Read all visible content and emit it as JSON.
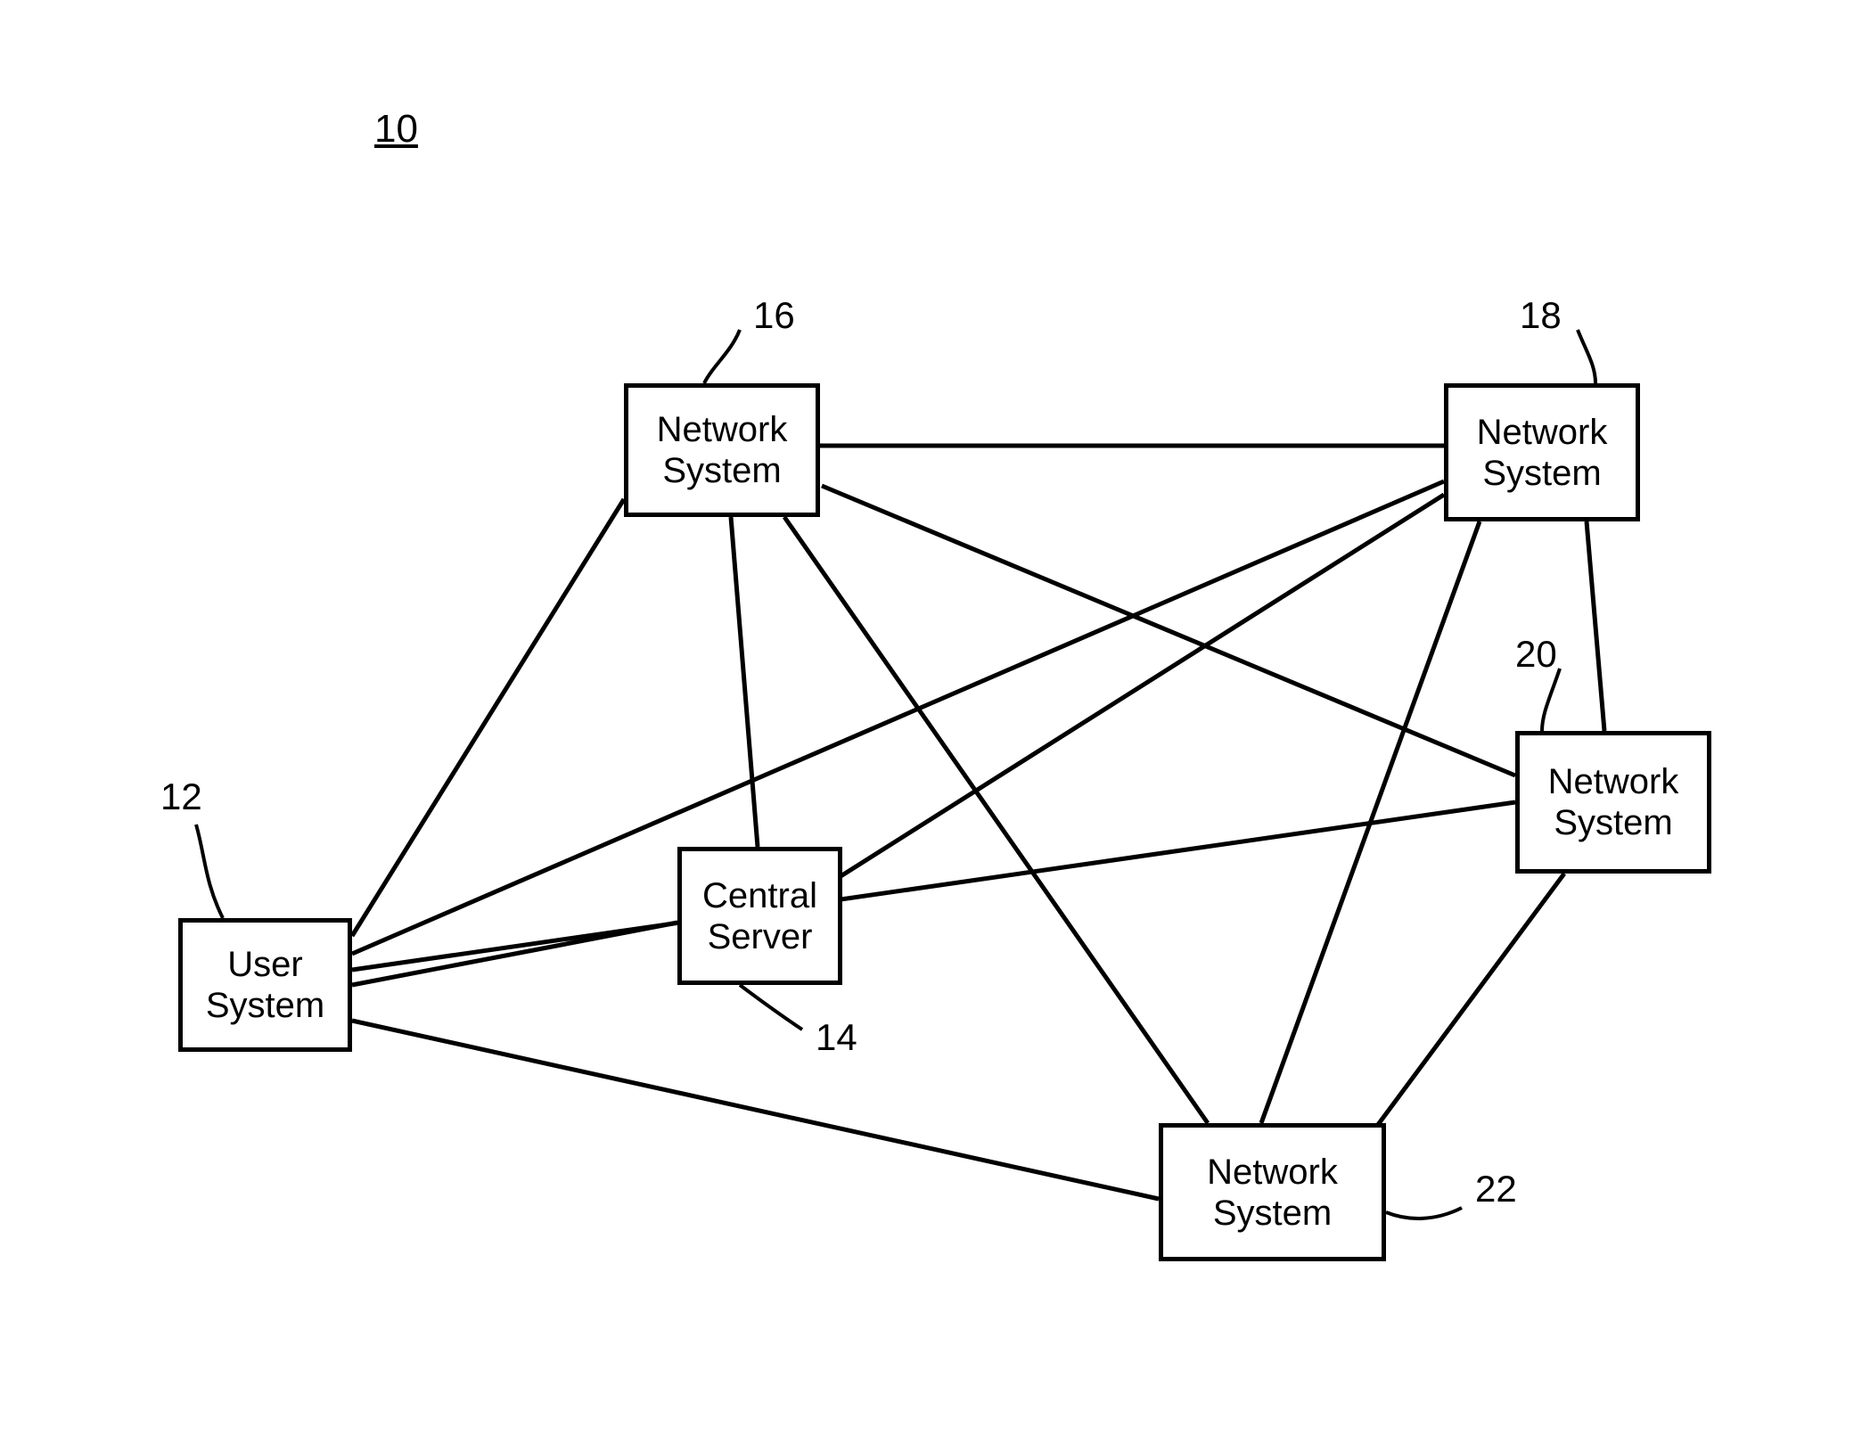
{
  "figure_ref": "10",
  "nodes": {
    "user_system": {
      "label": "User\nSystem",
      "ref": "12"
    },
    "central_server": {
      "label": "Central\nServer",
      "ref": "14"
    },
    "net16": {
      "label": "Network\nSystem",
      "ref": "16"
    },
    "net18": {
      "label": "Network\nSystem",
      "ref": "18"
    },
    "net20": {
      "label": "Network\nSystem",
      "ref": "20"
    },
    "net22": {
      "label": "Network\nSystem",
      "ref": "22"
    }
  }
}
